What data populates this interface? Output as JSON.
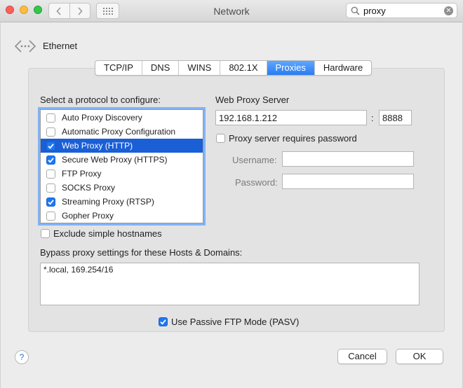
{
  "window": {
    "title": "Network"
  },
  "search": {
    "value": "proxy",
    "placeholder": "Search"
  },
  "icons": {
    "back": "chevron-left-icon",
    "forward": "chevron-right-icon",
    "show_all": "grid-icon",
    "search": "magnifier-icon",
    "clear": "clear-circle-icon",
    "interface": "ethernet-icon"
  },
  "interface": {
    "name": "Ethernet"
  },
  "tabs": [
    {
      "label": "TCP/IP",
      "active": false
    },
    {
      "label": "DNS",
      "active": false
    },
    {
      "label": "WINS",
      "active": false
    },
    {
      "label": "802.1X",
      "active": false
    },
    {
      "label": "Proxies",
      "active": true
    },
    {
      "label": "Hardware",
      "active": false
    }
  ],
  "protocols": {
    "heading": "Select a protocol to configure:",
    "items": [
      {
        "label": "Auto Proxy Discovery",
        "checked": false,
        "selected": false
      },
      {
        "label": "Automatic Proxy Configuration",
        "checked": false,
        "selected": false
      },
      {
        "label": "Web Proxy (HTTP)",
        "checked": true,
        "selected": true
      },
      {
        "label": "Secure Web Proxy (HTTPS)",
        "checked": true,
        "selected": false
      },
      {
        "label": "FTP Proxy",
        "checked": false,
        "selected": false
      },
      {
        "label": "SOCKS Proxy",
        "checked": false,
        "selected": false
      },
      {
        "label": "Streaming Proxy (RTSP)",
        "checked": true,
        "selected": false
      },
      {
        "label": "Gopher Proxy",
        "checked": false,
        "selected": false
      }
    ]
  },
  "server": {
    "heading": "Web Proxy Server",
    "host": "192.168.1.212",
    "separator": ":",
    "port": "8888",
    "requires_password_label": "Proxy server requires password",
    "requires_password": false,
    "username_label": "Username:",
    "username": "",
    "password_label": "Password:",
    "password": ""
  },
  "exclude": {
    "label": "Exclude simple hostnames",
    "checked": false
  },
  "bypass": {
    "label": "Bypass proxy settings for these Hosts & Domains:",
    "value": "*.local, 169.254/16"
  },
  "pasv": {
    "label": "Use Passive FTP Mode (PASV)",
    "checked": true
  },
  "buttons": {
    "help": "?",
    "cancel": "Cancel",
    "ok": "OK"
  },
  "colors": {
    "accent": "#1e77f2",
    "selection": "#1a5fd6"
  }
}
